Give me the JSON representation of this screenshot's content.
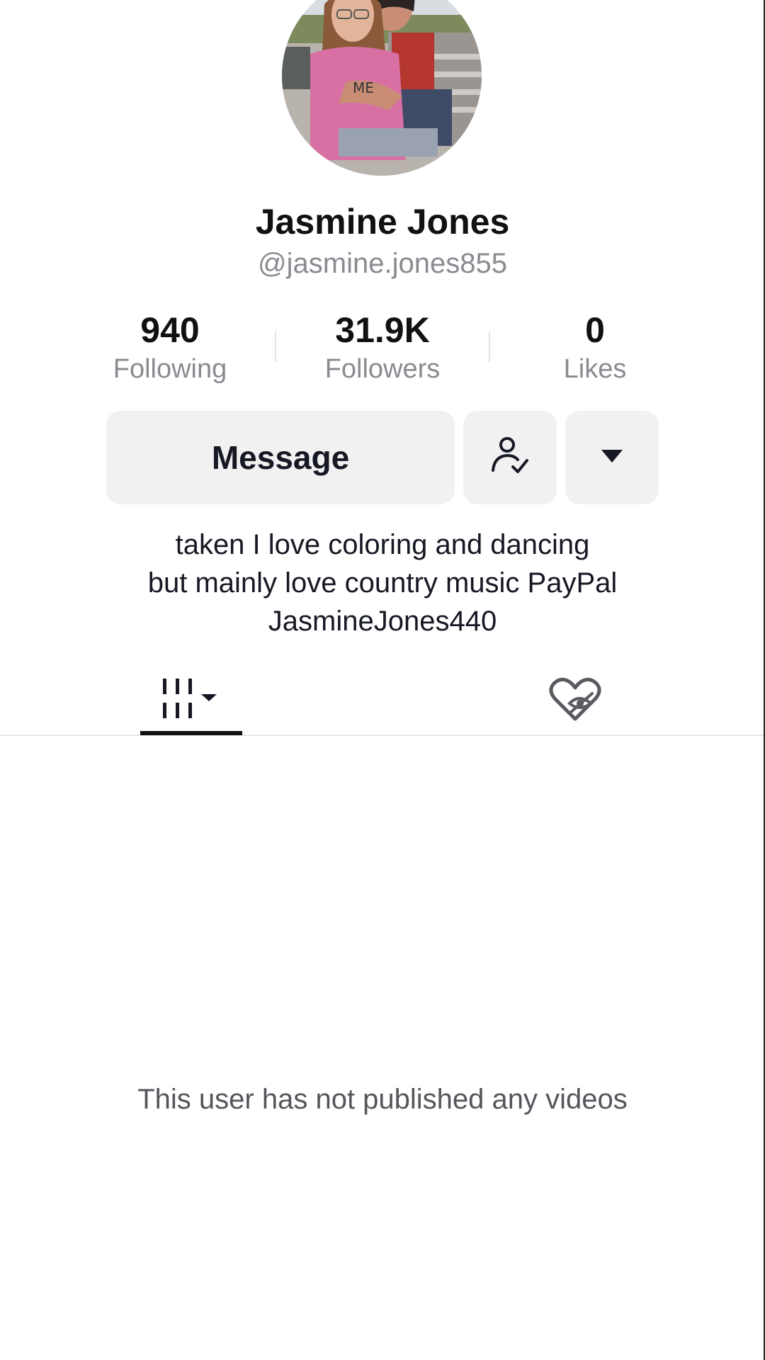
{
  "profile": {
    "name": "Jasmine Jones",
    "handle": "@jasmine.jones855",
    "bio_lines": [
      "taken I love coloring and dancing",
      "but mainly love country music PayPal",
      "JasmineJones440"
    ]
  },
  "stats": {
    "following": {
      "value": "940",
      "label": "Following"
    },
    "followers": {
      "value": "31.9K",
      "label": "Followers"
    },
    "likes": {
      "value": "0",
      "label": "Likes"
    }
  },
  "actions": {
    "message_label": "Message",
    "follow_icon": "user-check-icon",
    "more_icon": "caret-down-icon"
  },
  "tabs": [
    {
      "icon": "videos-grid-icon",
      "selected": true
    },
    {
      "icon": "liked-hidden-icon",
      "selected": false
    }
  ],
  "empty_state": "This user has not published any videos"
}
